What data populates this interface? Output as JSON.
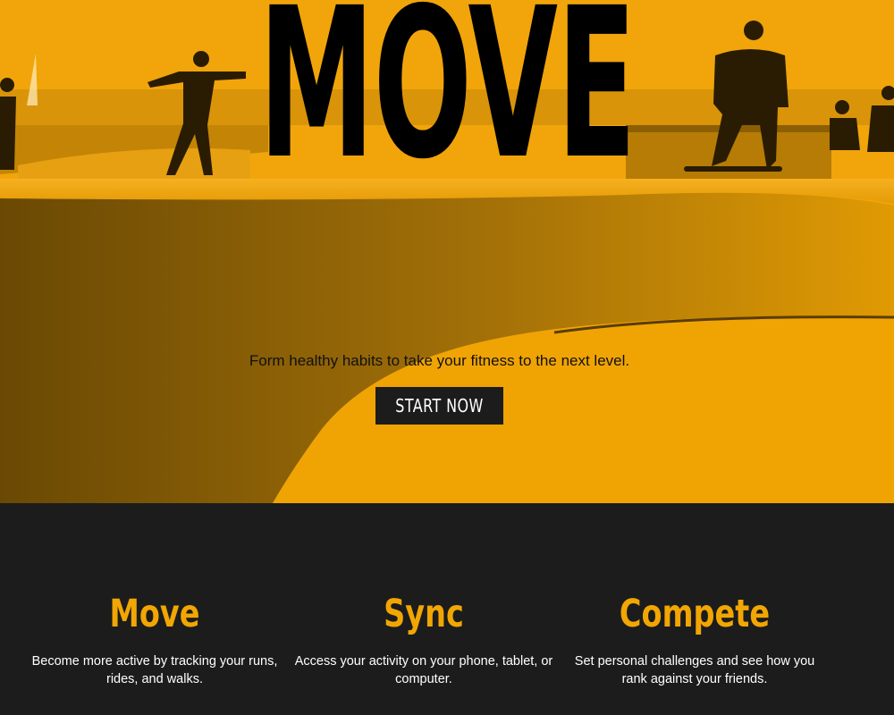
{
  "hero": {
    "title": "MOVE",
    "tagline": "Form healthy habits to take your fitness to the next level.",
    "cta_label": "START NOW"
  },
  "features": [
    {
      "title": "Move",
      "description": "Become more active by tracking your runs, rides, and walks."
    },
    {
      "title": "Sync",
      "description": "Access your activity on your phone, tablet, or computer."
    },
    {
      "title": "Compete",
      "description": "Set personal challenges and see how you rank against your friends."
    }
  ],
  "colors": {
    "accent": "#f2a603",
    "dark": "#1c1c1c",
    "text_light": "#ffffff"
  }
}
